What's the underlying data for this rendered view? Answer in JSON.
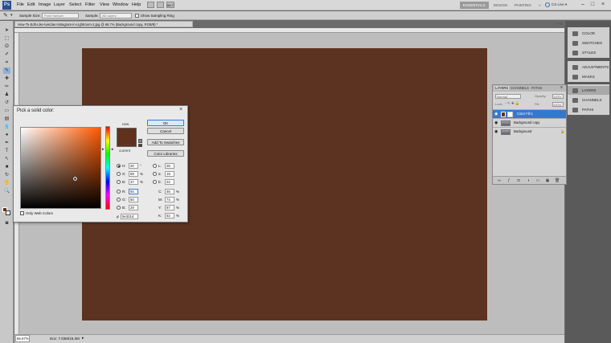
{
  "app": {
    "logo": "Ps"
  },
  "menus": [
    "File",
    "Edit",
    "Image",
    "Layer",
    "Select",
    "Filter",
    "View",
    "Window",
    "Help"
  ],
  "workspaces": [
    "ESSENTIALS",
    "DESIGN",
    "PAINTING",
    "»"
  ],
  "cs_live": "CS Live ▾",
  "options_bar": {
    "sample_size_label": "Sample Size:",
    "sample_size_value": "Point Sample",
    "sample_label": "Sample:",
    "sample_value": "All Layers",
    "show_ring_label": "Show Sampling Ring"
  },
  "document": {
    "tab_title": "How-To-Edit-Like-luisclas-Instagram-in-Lightroom-2.jpg @ 66.7% (Background copy, RGB/8) *",
    "fill_color": "#5e321d",
    "zoom": "66.67%",
    "doc_info": "Doc: 7.03M/16.3M"
  },
  "right_dock": {
    "group1": [
      "COLOR",
      "SWATCHES",
      "STYLES"
    ],
    "group2": [
      "ADJUSTMENTS",
      "MASKS"
    ],
    "group3": [
      "LAYERS",
      "CHANNELS",
      "PATHS"
    ]
  },
  "layers_panel": {
    "tabs": [
      "LAYERS",
      "CHANNELS",
      "PATHS"
    ],
    "blend_mode": "Normal",
    "opacity_label": "Opacity:",
    "opacity": "100%",
    "lock_label": "Lock:",
    "fill_label": "Fill:",
    "fill": "100%",
    "layers": [
      {
        "name": "Color Fill 1",
        "selected": true
      },
      {
        "name": "Background copy",
        "selected": false
      },
      {
        "name": "Background",
        "selected": false
      }
    ]
  },
  "color_picker": {
    "title": "Pick a solid color:",
    "new_label": "new",
    "current_label": "current",
    "ok": "OK",
    "cancel": "Cancel",
    "add_to_swatches": "Add To Swatches",
    "color_libraries": "Color Libraries",
    "only_web_colors": "Only Web Colors",
    "hex_prefix": "#",
    "hex": "5e321d",
    "selected_color": "#5e321d",
    "hsb": [
      {
        "label": "H:",
        "value": "20",
        "unit": "°"
      },
      {
        "label": "S:",
        "value": "69",
        "unit": "%"
      },
      {
        "label": "B:",
        "value": "37",
        "unit": "%"
      }
    ],
    "rgb": [
      {
        "label": "R:",
        "value": "94"
      },
      {
        "label": "G:",
        "value": "50"
      },
      {
        "label": "B:",
        "value": "29"
      }
    ],
    "lab": [
      {
        "label": "L:",
        "value": "26"
      },
      {
        "label": "a:",
        "value": "19"
      },
      {
        "label": "b:",
        "value": "22"
      }
    ],
    "cmyk": [
      {
        "label": "C:",
        "value": "46",
        "unit": "%"
      },
      {
        "label": "M:",
        "value": "74",
        "unit": "%"
      },
      {
        "label": "Y:",
        "value": "87",
        "unit": "%"
      },
      {
        "label": "K:",
        "value": "52",
        "unit": "%"
      }
    ]
  }
}
